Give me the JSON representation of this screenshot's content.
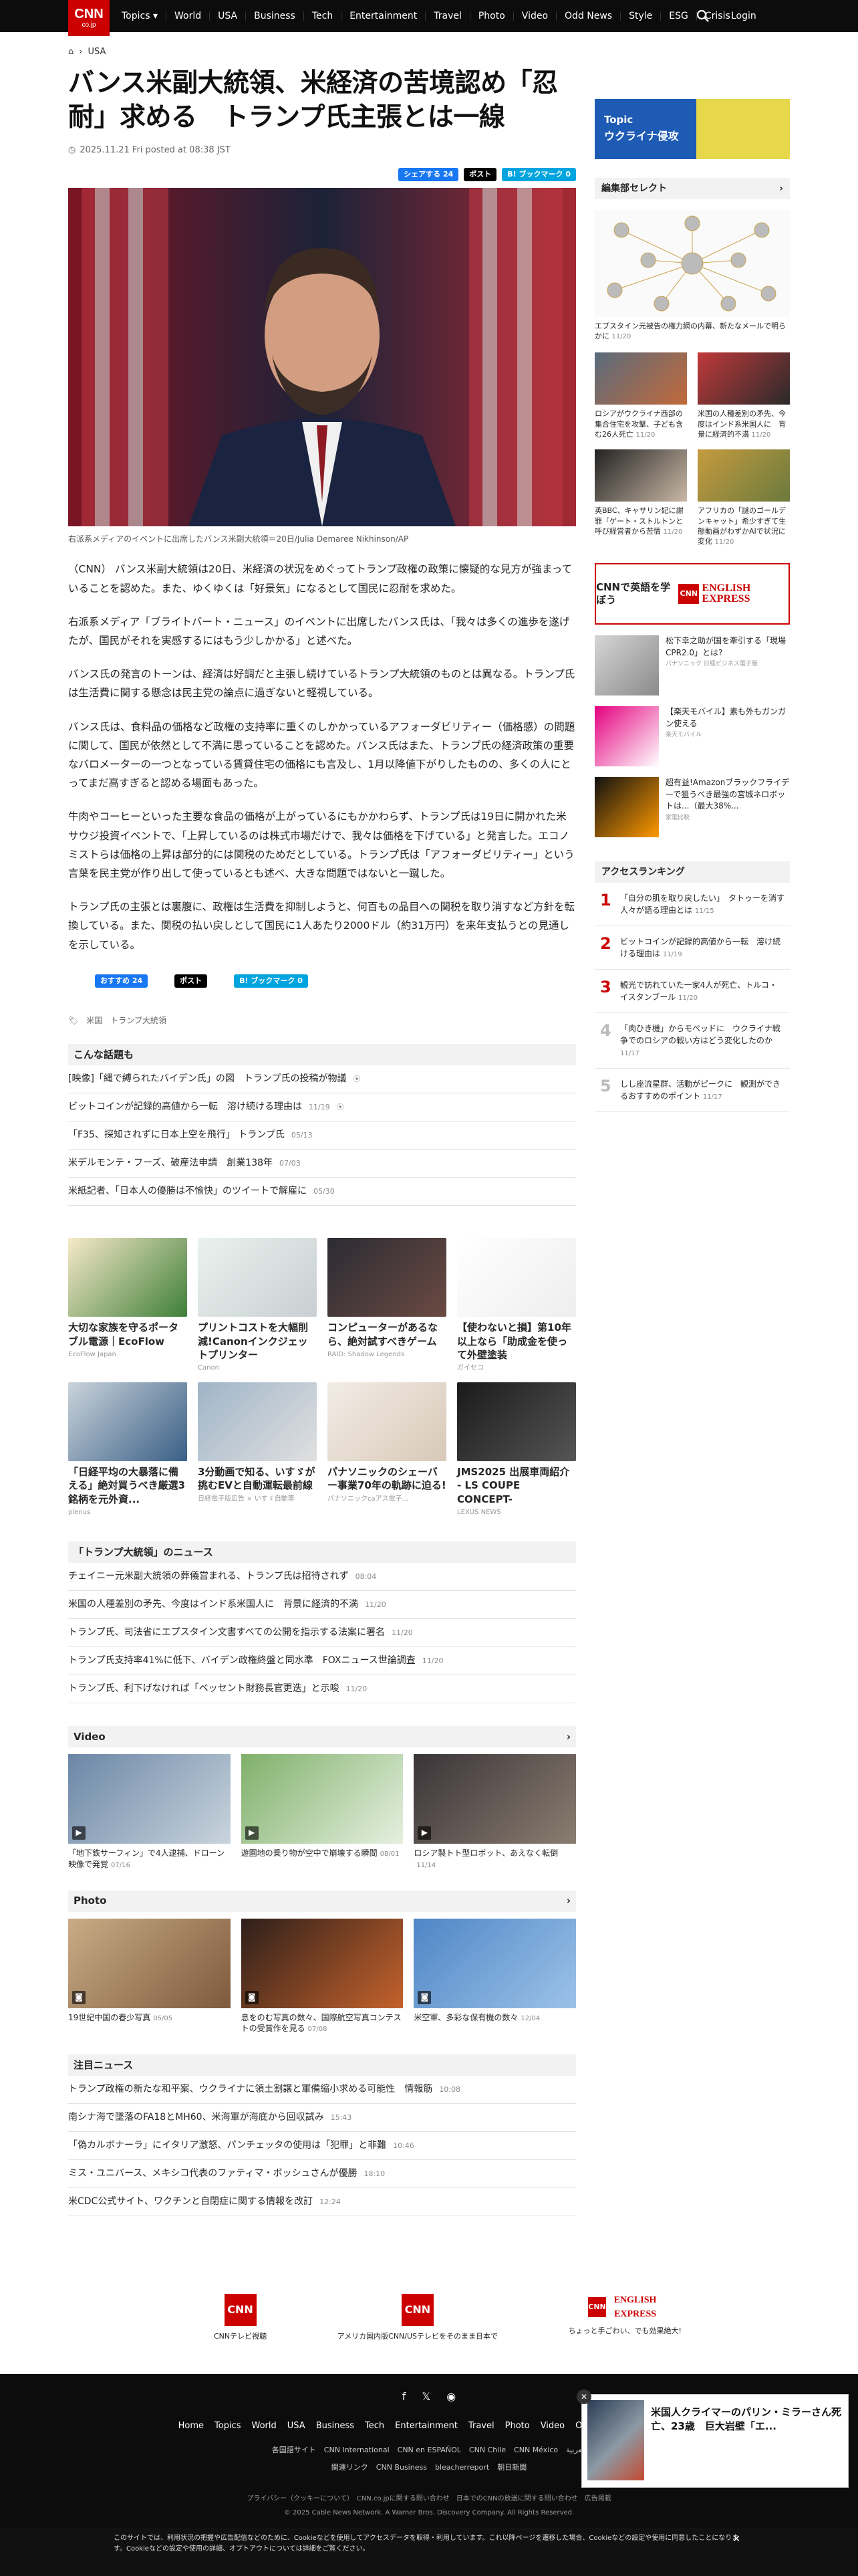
{
  "nav": {
    "items": [
      "Topics ▾",
      "World",
      "USA",
      "Business",
      "Tech",
      "Entertainment",
      "Travel",
      "Photo",
      "Video",
      "Odd News",
      "Style",
      "ESG",
      "Crisis"
    ],
    "login": "Login",
    "logo_sub": "co.jp"
  },
  "breadcrumb": {
    "section": "USA"
  },
  "article": {
    "title": "バンス米副大統領、米経済の苦境認め「忍耐」求める　トランプ氏主張とは一線",
    "date": "2025.11.21 Fri posted at 08:38 JST",
    "share": {
      "facebook": "シェアする 24",
      "x": "ポスト",
      "hatena": "B! ブックマーク 0"
    },
    "caption": "右派系メディアのイベントに出席したバンス米副大統領＝20日/Julia Demaree Nikhinson/AP",
    "paragraphs": [
      "（CNN） バンス米副大統領は20日、米経済の状況をめぐってトランプ政権の政策に懐疑的な見方が強まっていることを認めた。また、ゆくゆくは「好景気」になるとして国民に忍耐を求めた。",
      "右派系メディア「ブライトバート・ニュース」のイベントに出席したバンス氏は、「我々は多くの進歩を遂げたが、国民がそれを実感するにはもう少しかかる」と述べた。",
      "バンス氏の発言のトーンは、経済は好調だと主張し続けているトランプ大統領のものとは異なる。トランプ氏は生活費に関する懸念は民主党の論点に過ぎないと軽視している。",
      "バンス氏は、食料品の価格など政権の支持率に重くのしかかっているアフォーダビリティー（価格感）の問題に関して、国民が依然として不満に思っていることを認めた。バンス氏はまた、トランプ氏の経済政策の重要なバロメーターの一つとなっている賃貸住宅の価格にも言及し、1月以降値下がりしたものの、多くの人にとってまだ高すぎると認める場面もあった。",
      "牛肉やコーヒーといった主要な食品の価格が上がっているにもかかわらず、トランプ氏は19日に開かれた米サウジ投資イベントで、「上昇しているのは株式市場だけで、我々は価格を下げている」と発言した。エコノミストらは価格の上昇は部分的には関税のためだとしている。トランプ氏は「アフォーダビリティー」という言葉を民主党が作り出して使っているとも述べ、大きな問題ではないと一蹴した。",
      "トランプ氏の主張とは裏腹に、政権は生活費を抑制しようと、何百もの品目への関税を取り消すなど方針を転換している。また、関税の払い戻しとして国民に1人あたり2000ドル（約31万円）を来年支払うとの見通しを示している。"
    ],
    "bottom_share": {
      "like": "おすすめ 24",
      "x": "ポスト",
      "hatena": "B! ブックマーク 0"
    },
    "tags": [
      "米国",
      "トランプ大統領"
    ]
  },
  "related": {
    "heading": "こんな話題も",
    "items": [
      {
        "t": "[映像]「縄で縛られたバイデン氏」の図　トランプ氏の投稿が物議",
        "d": "",
        "video": true
      },
      {
        "t": "ビットコインが記録的高値から一転　溶け続ける理由は",
        "d": "11/19",
        "video": true
      },
      {
        "t": "「F35、探知されずに日本上空を飛行」 トランプ氏",
        "d": "05/13",
        "video": false
      },
      {
        "t": "米デルモンテ・フーズ、破産法申請　創業138年",
        "d": "07/03",
        "video": false
      },
      {
        "t": "米紙記者、「日本人の優勝は不愉快」のツイートで解雇に",
        "d": "05/30",
        "video": false
      }
    ]
  },
  "ads": [
    {
      "t": "大切な家族を守るポータブル電源｜EcoFlow",
      "s": "EcoFlow Japan",
      "c1": "#f6e9c8",
      "c2": "#3f7f3a"
    },
    {
      "t": "プリントコストを大幅削減!Canonインクジェットプリンター",
      "s": "Canon",
      "c1": "#e9f2ee",
      "c2": "#c9cfd2"
    },
    {
      "t": "コンピューターがあるなら、絶対試すべきゲーム",
      "s": "RAID: Shadow Legends",
      "c1": "#2b2b33",
      "c2": "#6b4a42"
    },
    {
      "t": "【使わないと損】第10年以上なら「助成金を使って外壁塗装",
      "s": "ガイセコ",
      "c1": "#ffffff",
      "c2": "#eeeeee"
    },
    {
      "t": "「日経平均の大暴落に備える」絶対買うべき厳選3銘柄を元外資...",
      "s": "plenus",
      "c1": "#c9d3db",
      "c2": "#3a5f86"
    },
    {
      "t": "3分動画で知る、いすゞが挑むEVと自動運転最前線",
      "s": "日経電子版広告 × いすゞ自動車",
      "c1": "#9fb4c8",
      "c2": "#e0e0e0"
    },
    {
      "t": "パナソニックのシェーバー事業70年の軌跡に迫る!",
      "s": "パナソニックcaアス電子...",
      "c1": "#f2ece6",
      "c2": "#d8c9b8"
    },
    {
      "t": "JMS2025 出展車両紹介 - LS COUPE CONCEPT-",
      "s": "LEXUS NEWS",
      "c1": "#1a1a1a",
      "c2": "#555555"
    }
  ],
  "trump_news": {
    "heading": "「トランプ大統領」のニュース",
    "items": [
      {
        "t": "チェイニー元米副大統領の葬儀営まれる、トランプ氏は招待されず",
        "d": "08:04"
      },
      {
        "t": "米国の人種差別の矛先、今度はインド系米国人に　背景に経済的不満",
        "d": "11/20"
      },
      {
        "t": "トランプ氏、司法省にエプスタイン文書すべての公開を指示する法案に署名",
        "d": "11/20"
      },
      {
        "t": "トランプ氏支持率41%に低下、バイデン政権終盤と同水準　FOXニュース世論調査",
        "d": "11/20"
      },
      {
        "t": "トランプ氏、利下げなければ「ベッセント財務長官更迭」と示唆",
        "d": "11/20"
      }
    ]
  },
  "video": {
    "heading": "Video",
    "items": [
      {
        "t": "「地下鉄サーフィン」で4人逮捕、ドローン映像で発覚",
        "d": "07/16",
        "c1": "#6b86a6",
        "c2": "#c9d4dd"
      },
      {
        "t": "遊園地の乗り物が空中で崩壊する瞬間",
        "d": "08/01",
        "c1": "#7fb06a",
        "c2": "#e6f0e0"
      },
      {
        "t": "ロシア製トト型ロボット、あえなく転倒",
        "d": "11/14",
        "c1": "#3a3438",
        "c2": "#8a7d70"
      }
    ]
  },
  "photo": {
    "heading": "Photo",
    "items": [
      {
        "t": "19世紀中国の春少写真",
        "d": "05/05",
        "c1": "#c9ac86",
        "c2": "#7d5a3d"
      },
      {
        "t": "息をのむ写真の数々、国際航空写真コンテストの受賞作を見る",
        "d": "07/08",
        "c1": "#2e1f1a",
        "c2": "#c4622c"
      },
      {
        "t": "米空軍、多彩な保有機の数々",
        "d": "12/04",
        "c1": "#4f86c6",
        "c2": "#9cc2e8"
      }
    ]
  },
  "notable": {
    "heading": "注目ニュース",
    "items": [
      {
        "t": "トランプ政権の新たな和平案、ウクライナに領土割譲と軍備縮小求める可能性　情報筋",
        "d": "10:08"
      },
      {
        "t": "南シナ海で墜落のFA18とMH60、米海軍が海底から回収試み",
        "d": "15:43"
      },
      {
        "t": "「偽カルボナーラ」にイタリア激怒、パンチェッタの使用は「犯罪」と非難",
        "d": "10:46"
      },
      {
        "t": "ミス・ユニバース、メキシコ代表のファティマ・ボッシュさんが優勝",
        "d": "18:10"
      },
      {
        "t": "米CDC公式サイト、ワクチンと自閉症に関する情報を改訂",
        "d": "12:24"
      }
    ]
  },
  "footer_logos": [
    {
      "name": "CNN",
      "cap": "CNNテレビ視聴"
    },
    {
      "name": "CNN",
      "cap": "アメリカ国内版CNN/USテレビをそのまま日本で"
    },
    {
      "name": "ENGLISH EXPRESS",
      "cap": "ちょっと手ごわい、でも効果絶大!"
    }
  ],
  "footer": {
    "nav": [
      "Home",
      "Topics",
      "World",
      "USA",
      "Business",
      "Tech",
      "Entertainment",
      "Travel",
      "Photo",
      "Video",
      "Odd News",
      "Style",
      "RSS"
    ],
    "sub": [
      "各国語サイト",
      "CNN International",
      "CNN en ESPAÑOL",
      "CNN Chile",
      "CNN México",
      "العربية"
    ],
    "sub2": [
      "関連リンク",
      "CNN Business",
      "bleacherreport",
      "朝日新聞"
    ],
    "legal": "プライバシー（クッキーについて）　CNN.co.jpに関する問い合わせ　日本でのCNNの放送に関する問い合わせ　広告掲載",
    "copy": "© 2025 Cable News Network. A Warner Bros. Discovery Company. All Rights Reserved."
  },
  "cookie": {
    "text": "このサイトでは、利用状況の把握や広告配信などのために、Cookieなどを使用してアクセスデータを取得・利用しています。これ以降ページを遷移した場合、Cookieなどの設定や使用に同意したことになります。Cookieなどの設定や使用の詳細、オプトアウトについては詳細をご覧ください。"
  },
  "popup": {
    "title": "米国人クライマーのパリン・ミラーさん死亡、23歳　巨大岩壁「エ..."
  },
  "sidebar": {
    "topic_label": "Topic",
    "topic_title": "ウクライナ侵攻",
    "select_heading": "編集部セレクト",
    "select_main": {
      "t": "エプスタイン元被告の権力網の内幕、新たなメールで明らかに",
      "d": "11/20"
    },
    "select_items": [
      {
        "t": "ロシアがウクライナ西部の集合住宅を攻撃、子ども含む26人死亡",
        "d": "11/20",
        "c1": "#5a6b7d",
        "c2": "#c26a3a"
      },
      {
        "t": "米国の人種差別の矛先、今度はインド系米国人に　背景に経済的不満",
        "d": "11/20",
        "c1": "#c0393b",
        "c2": "#2a2a2a"
      },
      {
        "t": "英BBC、キャサリン妃に謝罪「ゲート・ストルトンと呼び経営者から苦情",
        "d": "11/20",
        "c1": "#222222",
        "c2": "#c9b8a6"
      },
      {
        "t": "アフリカの「謎のゴールデンキャット」希少すぎて生態動画がわずかAIで状況に変化",
        "d": "11/20",
        "c1": "#c59b3f",
        "c2": "#6b7a3d"
      }
    ],
    "english_cta": "CNNで英語を学ぼう",
    "side_ads": [
      {
        "t": "松下幸之助が国を牽引する「現場CPR2.0」とは?",
        "s": "パナソニック 日経ビジネス電子版",
        "c1": "#d6d6d6",
        "c2": "#8a8a8a"
      },
      {
        "t": "【楽天モバイル】素も外もガンガン使える",
        "s": "楽天モバイル",
        "c1": "#e4007f",
        "c2": "#ffffff"
      },
      {
        "t": "超有益!Amazonブラックフライデーで狙うべき最強の宮城ネロボットは...（最大38%...",
        "s": "家電比較",
        "c1": "#111111",
        "c2": "#ff9900"
      }
    ],
    "ranking_heading": "アクセスランキング",
    "ranking": [
      {
        "n": "1",
        "t": "「自分の肌を取り戻したい」　タトゥーを消す人々が語る理由とは",
        "d": "11/15"
      },
      {
        "n": "2",
        "t": "ビットコインが記録的高値から一転　溶け続ける理由は",
        "d": "11/19"
      },
      {
        "n": "3",
        "t": "観光で訪れていた一家4人が死亡、トルコ・イスタンブール",
        "d": "11/20"
      },
      {
        "n": "4",
        "t": "「肉ひき機」からモぺッドに　ウクライナ戦争でのロシアの戦い方はどう変化したのか",
        "d": "11/17"
      },
      {
        "n": "5",
        "t": "しし座流星群、活動がピークに　観測ができるおすすめのポイント",
        "d": "11/17"
      }
    ]
  }
}
